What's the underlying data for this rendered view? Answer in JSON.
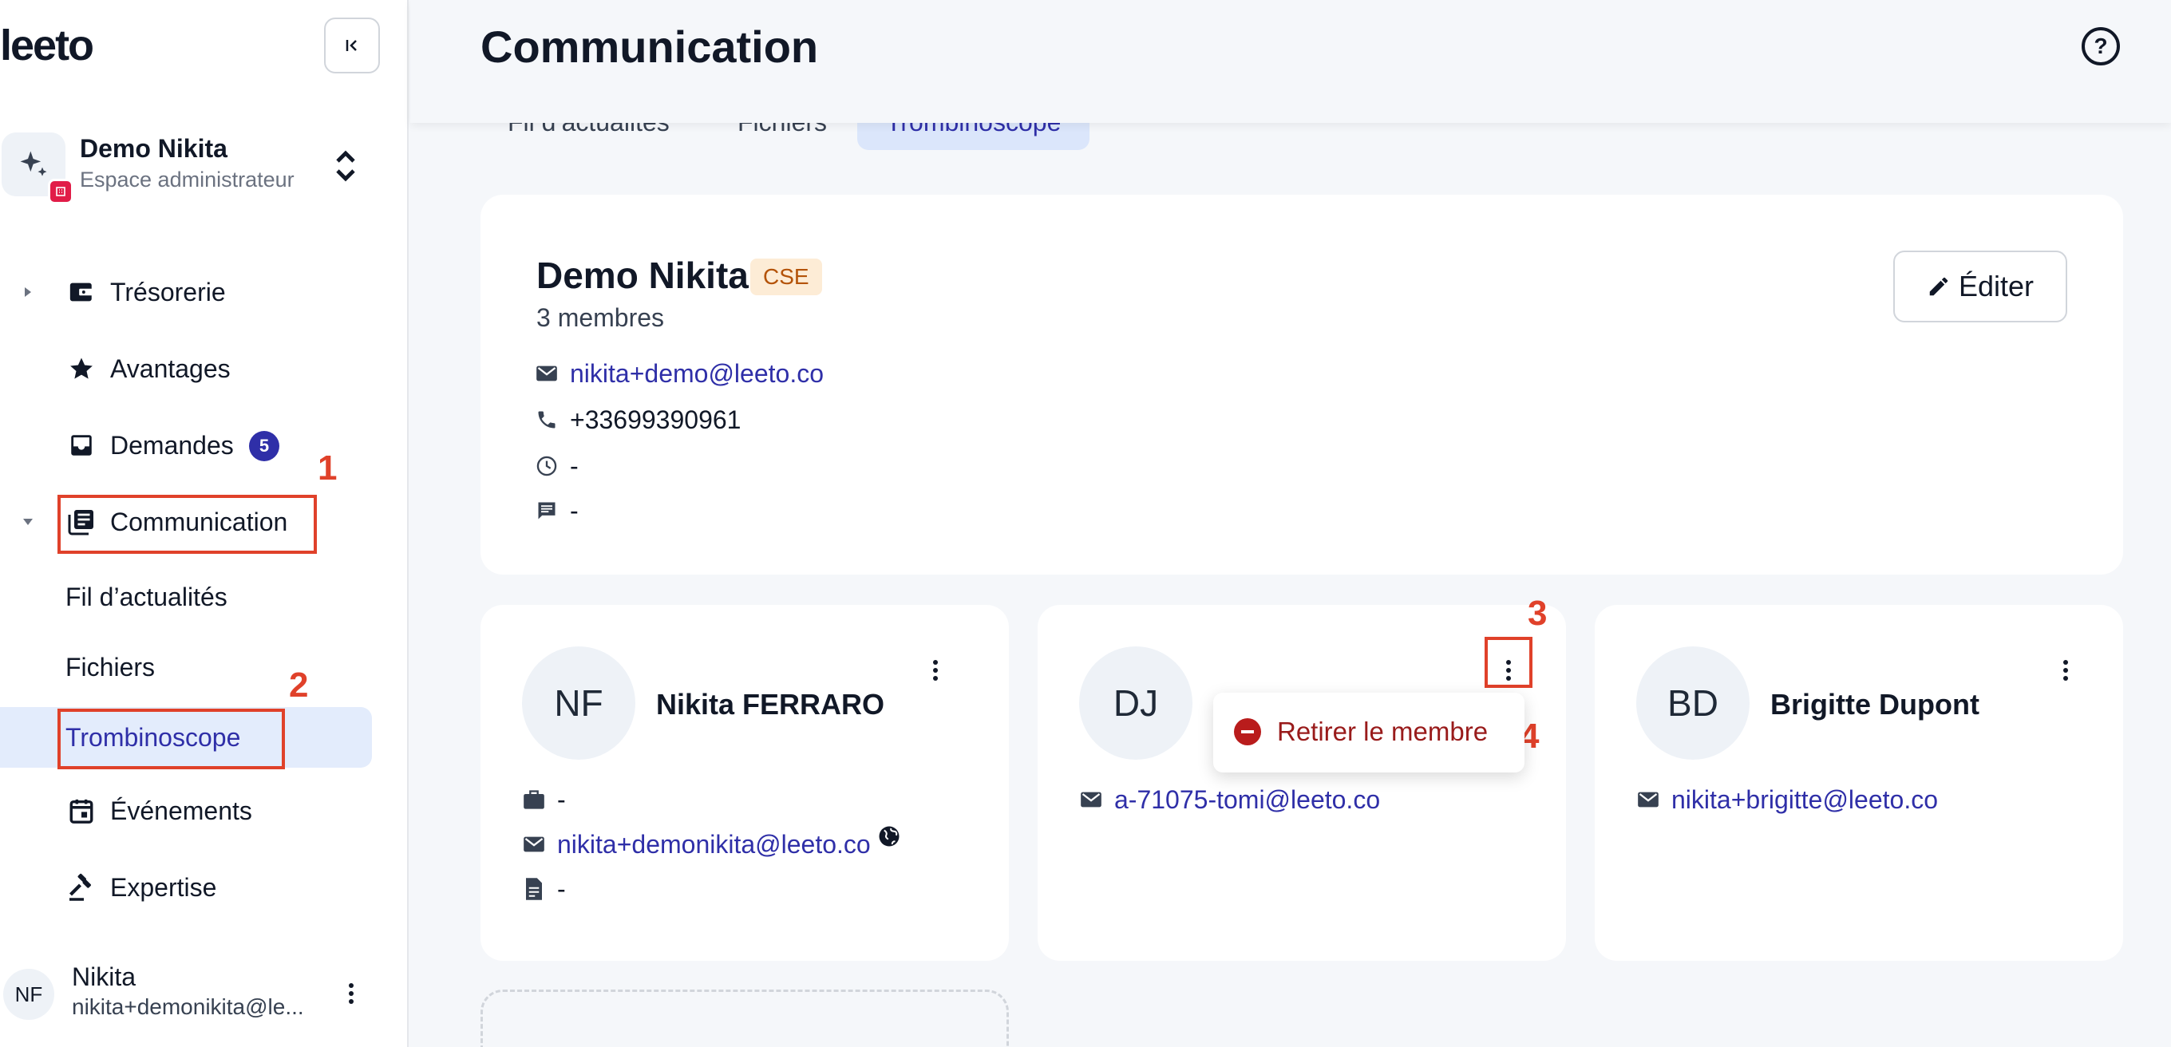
{
  "sidebar": {
    "logo": "leeto",
    "org": {
      "name": "Demo Nikita",
      "subtitle": "Espace administrateur"
    },
    "nav": {
      "tresorerie": "Trésorerie",
      "avantages": "Avantages",
      "demandes": "Demandes",
      "demandes_count": "5",
      "communication": "Communication",
      "evenements": "Événements",
      "expertise": "Expertise"
    },
    "sub": {
      "fil": "Fil d’actualités",
      "fichiers": "Fichiers",
      "trombinoscope": "Trombinoscope"
    },
    "user": {
      "initials": "NF",
      "name": "Nikita",
      "email": "nikita+demonikita@le..."
    }
  },
  "header": {
    "title": "Communication"
  },
  "tabs": [
    {
      "label": "Fil d’actualités"
    },
    {
      "label": "Fichiers"
    },
    {
      "label": "Trombinoscope",
      "active": true
    }
  ],
  "group": {
    "name": "Demo Nikita",
    "tag": "CSE",
    "members_count": "3 membres",
    "email": "nikita+demo@leeto.co",
    "phone": "+33699390961",
    "hours": "-",
    "comment": "-",
    "edit_label": "Éditer"
  },
  "members": [
    {
      "initials": "NF",
      "name": "Nikita FERRARO",
      "job": "-",
      "email": "nikita+demonikita@leeto.co",
      "doc": "-"
    },
    {
      "initials": "DJ",
      "name": "",
      "email": "a-71075-tomi@leeto.co"
    },
    {
      "initials": "BD",
      "name": "Brigitte Dupont",
      "email": "nikita+brigitte@leeto.co"
    }
  ],
  "popup": {
    "remove_label": "Retirer le membre"
  },
  "annotations": [
    "1",
    "2",
    "3",
    "4"
  ],
  "colors": {
    "accent": "#2f2fa8",
    "annotation": "#e0412a",
    "active_bg": "#e3ecfc",
    "danger": "#b91c1c"
  }
}
